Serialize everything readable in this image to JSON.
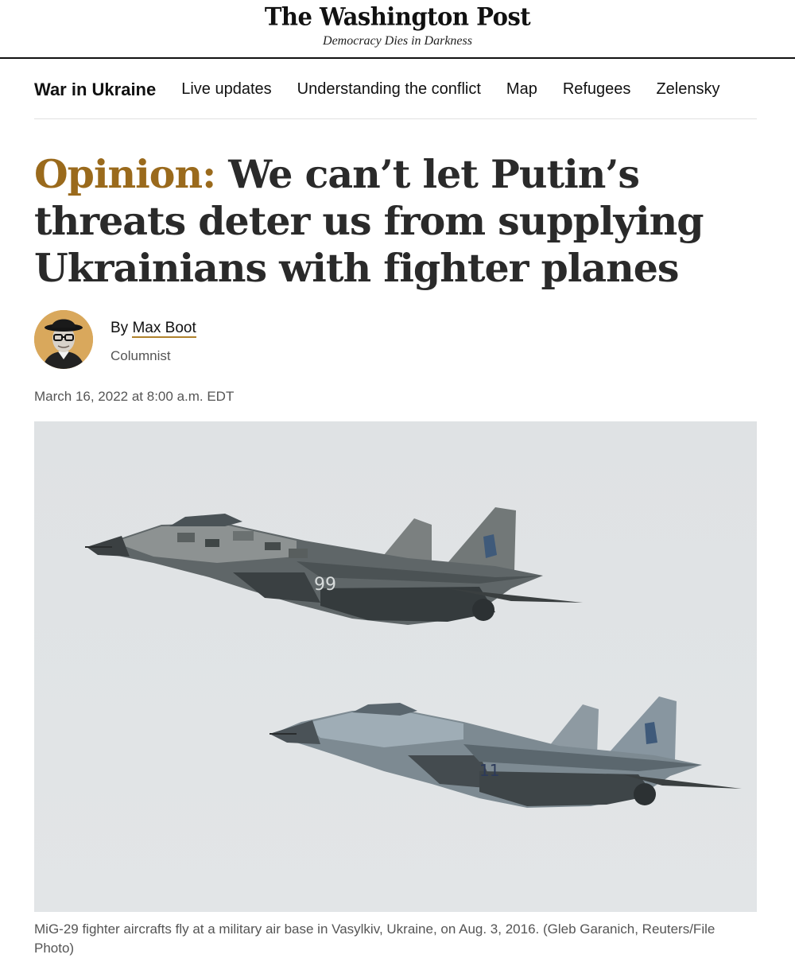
{
  "masthead": {
    "logo": "The Washington Post",
    "tagline": "Democracy Dies in Darkness"
  },
  "section_nav": {
    "title": "War in Ukraine",
    "links": [
      "Live updates",
      "Understanding the conflict",
      "Map",
      "Refugees",
      "Zelensky"
    ]
  },
  "article": {
    "kicker": "Opinion:",
    "headline": "We can’t let Putin’s threats deter us from supplying Ukrainians with fighter planes",
    "byline_prefix": "By",
    "author": "Max Boot",
    "author_role": "Columnist",
    "timestamp": "March 16, 2022 at 8:00 a.m. EDT"
  },
  "photo": {
    "aircraft_numbers": [
      "99",
      "11"
    ],
    "caption": "MiG-29 fighter aircrafts fly at a military air base in Vasylkiv, Ukraine, on Aug. 3, 2016. (Gleb Garanich, Reuters/File Photo)"
  },
  "colors": {
    "opinion_accent": "#9a6a1c",
    "author_underline": "#b0822c",
    "avatar_background": "#d9a85c"
  }
}
